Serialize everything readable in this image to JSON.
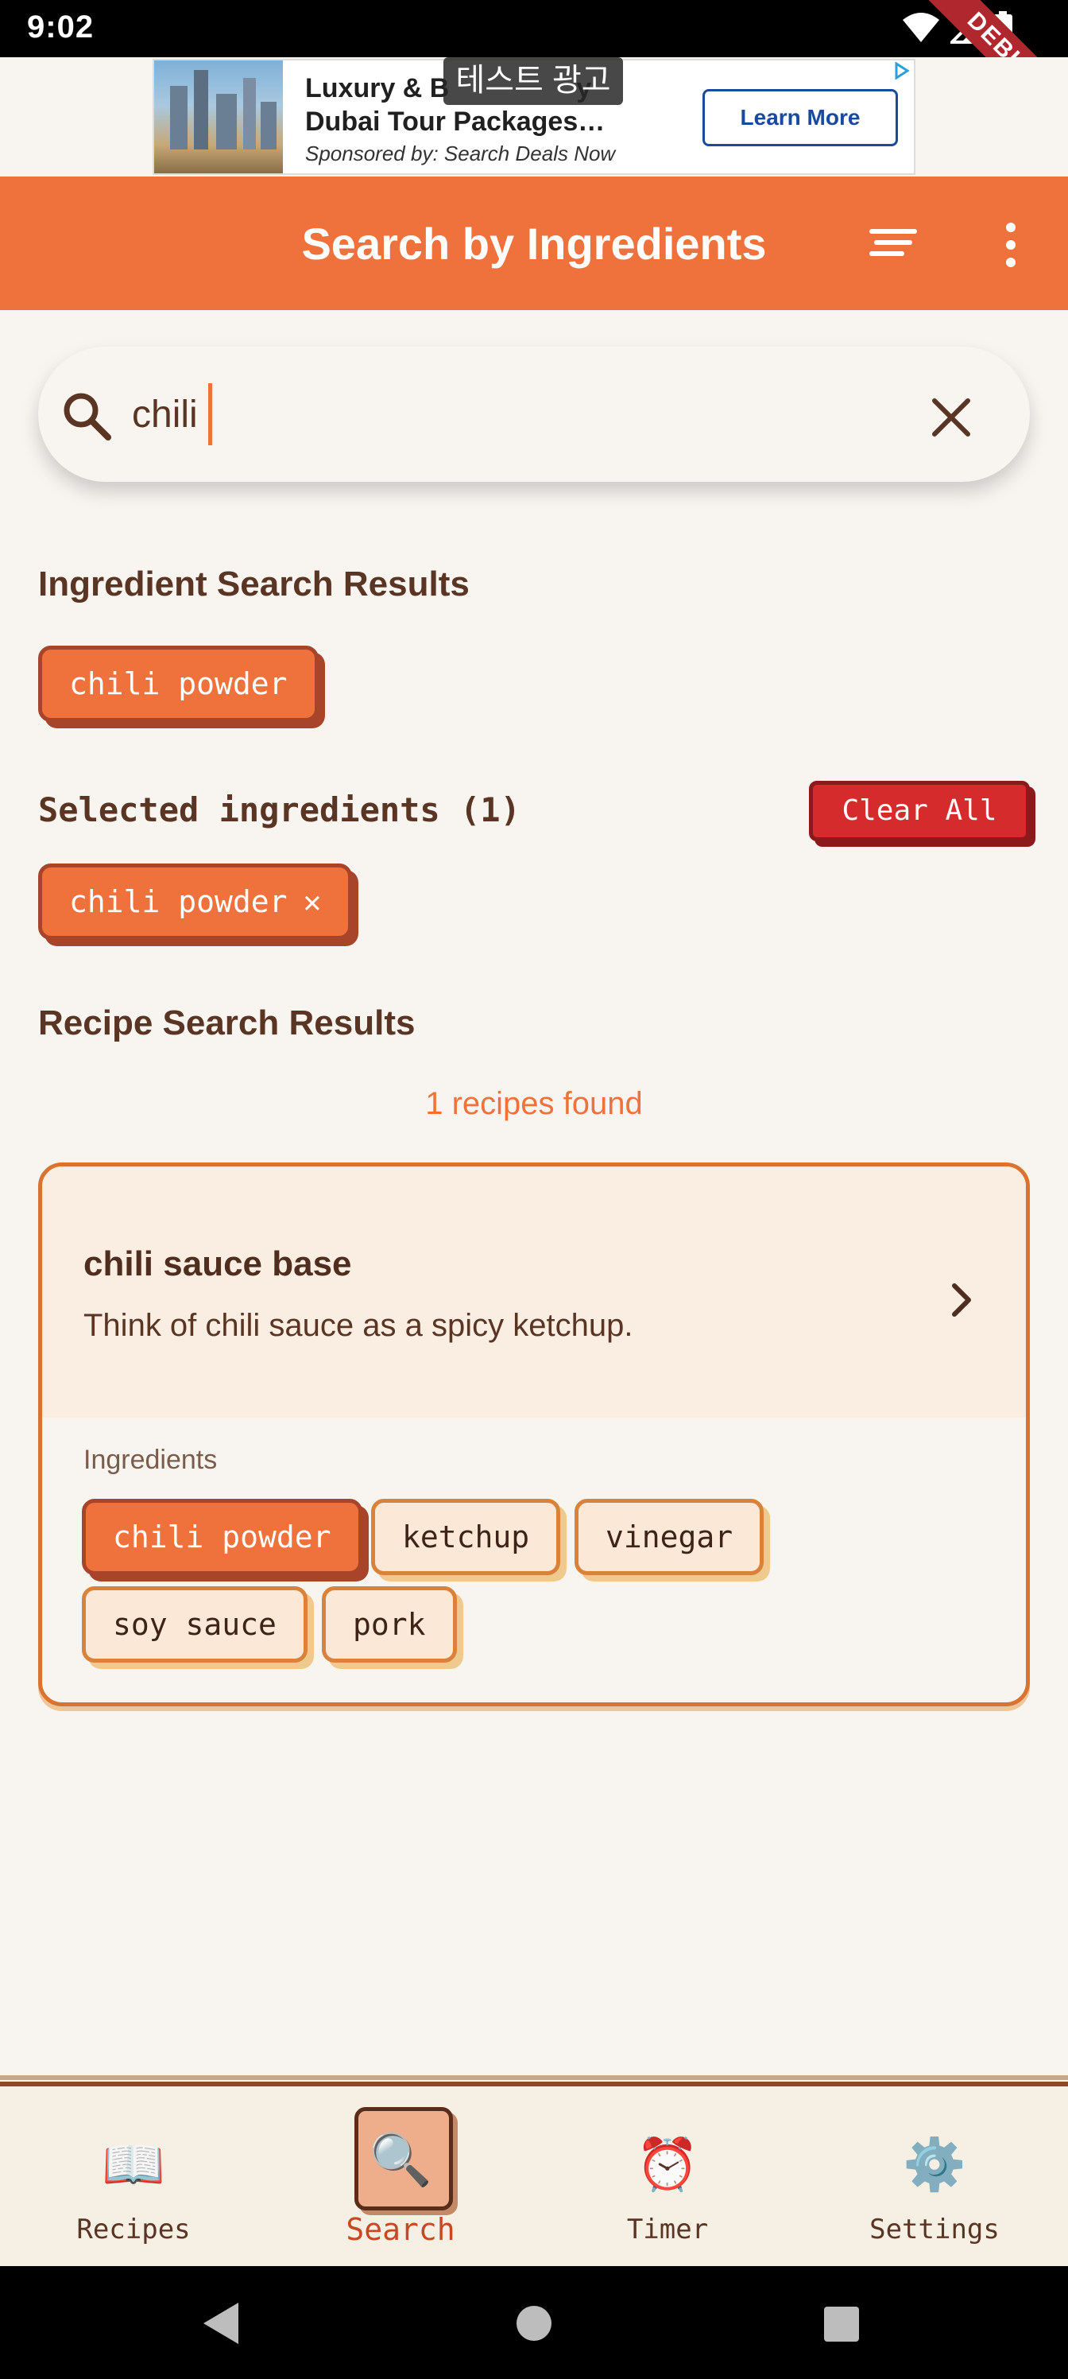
{
  "status": {
    "time": "9:02",
    "debug": "DEBUG"
  },
  "ad": {
    "title": "Luxury & B      y Dubai Tour Packages…",
    "title_line1": "Luxury & B",
    "title_line1b": "y",
    "title_line2": "Dubai Tour Packages…",
    "sponsor": "Sponsored by: Search Deals Now",
    "cta": "Learn More",
    "test_tag": "테스트 광고"
  },
  "appbar": {
    "title": "Search by Ingredients"
  },
  "search": {
    "value": "chili",
    "placeholder": ""
  },
  "ingredient_results": {
    "title": "Ingredient Search Results",
    "chips": [
      "chili powder"
    ]
  },
  "selected": {
    "title": "Selected ingredients (1)",
    "clear_all": "Clear All",
    "chips": [
      "chili powder"
    ],
    "remove_glyph": "✕"
  },
  "recipes": {
    "title": "Recipe Search Results",
    "found": "1 recipes found",
    "items": [
      {
        "title": "chili sauce base",
        "description": "Think of chili sauce as a spicy ketchup.",
        "ingredients_label": "Ingredients",
        "ingredients": [
          "chili powder",
          "ketchup",
          "vinegar",
          "soy sauce",
          "pork"
        ]
      }
    ]
  },
  "bottom_nav": [
    {
      "label": "Recipes",
      "icon": "open-book-icon",
      "glyph": "📖"
    },
    {
      "label": "Search",
      "icon": "magnifier-icon",
      "glyph": "🔍"
    },
    {
      "label": "Timer",
      "icon": "alarm-clock-icon",
      "glyph": "⏰"
    },
    {
      "label": "Settings",
      "icon": "gear-icon",
      "glyph": "⚙️"
    }
  ],
  "colors": {
    "accent": "#ef723c",
    "background": "#f8f5f1",
    "text": "#5a3524",
    "danger": "#d62b2d"
  }
}
